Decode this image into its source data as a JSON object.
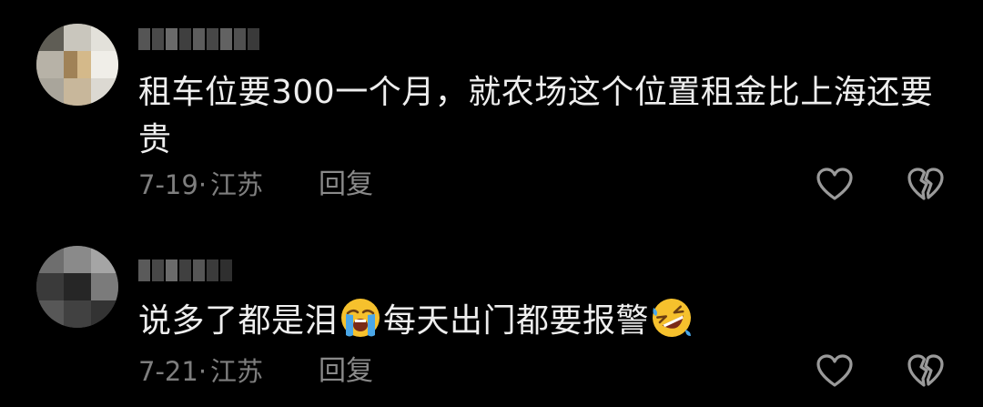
{
  "comments": [
    {
      "text": "租车位要300一个月，就农场这个位置租金比上海还要贵",
      "date": "7-19",
      "location": "江苏",
      "reply_label": "回复",
      "like_icon": "heart-outline-icon",
      "dislike_icon": "broken-heart-icon"
    },
    {
      "text_part1": "说多了都是泪",
      "emoji1": "loudly-crying-face-emoji",
      "text_part2": "每天出门都要报警",
      "emoji2": "rolling-on-floor-laughing-emoji",
      "date": "7-21",
      "location": "江苏",
      "reply_label": "回复",
      "like_icon": "heart-outline-icon",
      "dislike_icon": "broken-heart-icon"
    }
  ],
  "colors": {
    "background": "#000000",
    "text": "#eeeeee",
    "meta": "#7e7e7e",
    "icon": "#9a9a9a"
  }
}
